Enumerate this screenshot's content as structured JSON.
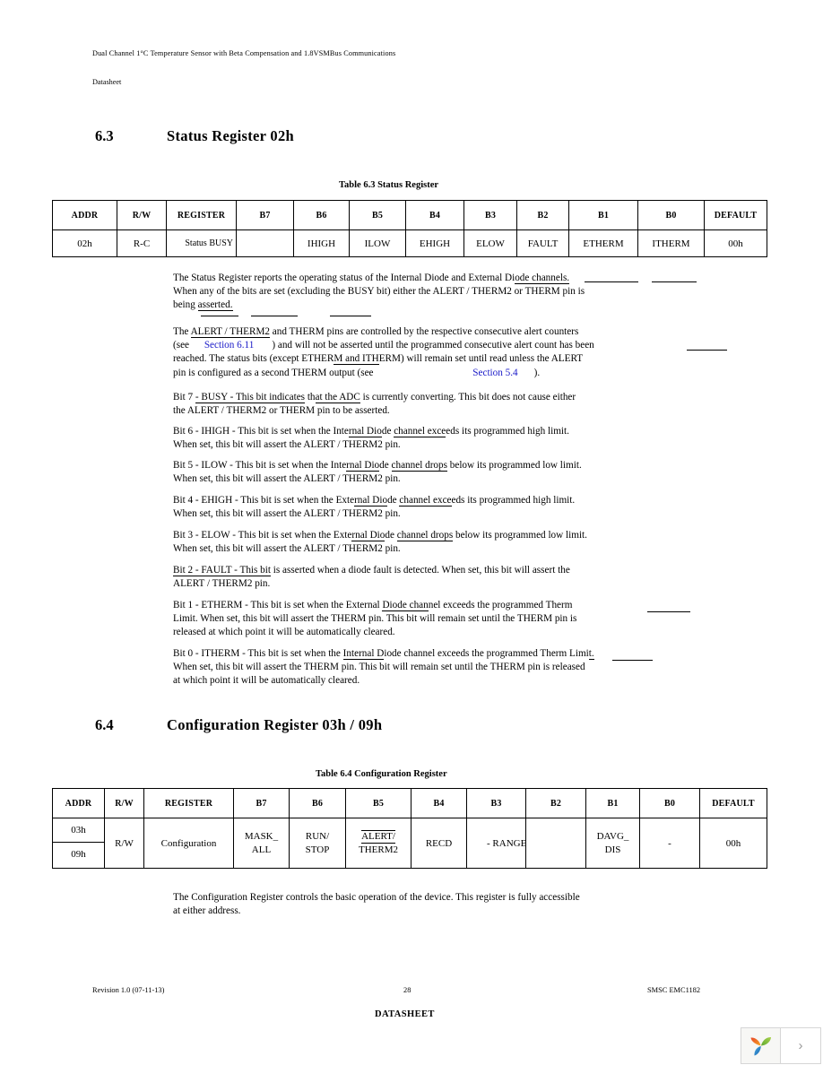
{
  "header": {
    "title": "Dual Channel 1°C Temperature Sensor with Beta Compensation and 1.8VSMBus Communications",
    "subtitle": "Datasheet"
  },
  "sections": [
    {
      "number": "6.3",
      "title": "Status Register 02h"
    },
    {
      "number": "6.4",
      "title": "Configuration Register 03h / 09h"
    }
  ],
  "status_table": {
    "caption": "Table 6.3  Status Register",
    "headers": [
      "ADDR",
      "R/W",
      "REGISTER",
      "B7",
      "B6",
      "B5",
      "B4",
      "B3",
      "B2",
      "B1",
      "B0",
      "DEFAULT"
    ],
    "row": [
      "02h",
      "R-C",
      "Status BUSY",
      "",
      "IHIGH",
      "ILOW",
      "EHIGH",
      "ELOW",
      "FAULT",
      "ETHERM",
      "ITHERM",
      "00h"
    ]
  },
  "config_table": {
    "caption": "Table 6.4  Configuration Register",
    "headers": [
      "ADDR",
      "R/W",
      "REGISTER",
      "B7",
      "B6",
      "B5",
      "B4",
      "B3",
      "B2",
      "B1",
      "B0",
      "DEFAULT"
    ],
    "addr_top": "03h",
    "addr_bottom": "09h",
    "rw": "R/W",
    "register": "Configuration",
    "b7_line1": "MASK_",
    "b7_line2": "ALL",
    "b6_line1": "RUN/",
    "b6_line2": "STOP",
    "b5_line1": "ALERT/",
    "b5_line2": "THERM2",
    "b4": "RECD",
    "b3": "- RANGE",
    "b2": "",
    "b1_line1": "DAVG_",
    "b1_line2": "DIS",
    "b0": "-",
    "default": "00h"
  },
  "body": {
    "p1_l1_a": "The Status Register reports the operating status of the Internal Diode and External Di",
    "p1_l1_b": "ode channels.",
    "p1_l2": "When any of the bits are set (excluding the BUSY bit) either the ALERT / THERM2 or THERM pin is",
    "p1_l3_a": "being ",
    "p1_l3_b": "asserted.",
    "p2_l1_a": "The ",
    "p2_l1_b": "ALERT / THERM2",
    "p2_l1_c": " and THERM pins are controlled by the respective consecutive alert counters",
    "p2_l2_a": "(see ",
    "p2_l2_link": "Section 6.11",
    "p2_l2_b": ") and will not be asserted until the programmed consecutive alert count has been",
    "p2_l3_a": "reached. The status bits (except ETHER",
    "p2_l3_b": "M and ITH",
    "p2_l3_c": "ERM) will remain set until read unless the ALERT",
    "p2_l4_a": "pin is configured as a second THERM output (see ",
    "p2_l4_link": "Section 5.4",
    "p2_l4_b": ").",
    "p3_l1_a": "Bit 7 ",
    "p3_l1_b": "- BUSY -",
    "p3_l1_c": " This bit indicates",
    "p3_l1_d": " th",
    "p3_l1_e": "at the ADC",
    "p3_l1_f": " is currently converting. This bit does not cause either",
    "p3_l2": "the ALERT / THERM2 or THERM pin to be asserted.",
    "p4_l1_a": "Bit 6 - IHIGH - This bit is set when the Inte",
    "p4_l1_b": "rnal Dio",
    "p4_l1_c": "de ",
    "p4_l1_d": "channel exce",
    "p4_l1_e": "eds its programmed high limit.",
    "p4_l2": "When set, this bit will assert the ALERT / THERM2 pin.",
    "p5_l1_a": "Bit 5 - ILOW - This bit is set when the Inte",
    "p5_l1_b": "rnal Dio",
    "p5_l1_c": "de ",
    "p5_l1_d": "channel drops",
    "p5_l1_e": " below its programmed low limit.",
    "p5_l2": "When set, this bit will assert the ALERT / THERM2 pin.",
    "p6_l1_a": "Bit 4 - EHIGH - This bit is set when the Exte",
    "p6_l1_b": "rnal Dio",
    "p6_l1_c": "de ",
    "p6_l1_d": "channel exce",
    "p6_l1_e": "eds its programmed high limit.",
    "p6_l2": "When set, this bit will assert the ALERT / THERM2 pin.",
    "p7_l1_a": "Bit 3 - ELOW - This bit is set when the Exte",
    "p7_l1_b": "rnal Dio",
    "p7_l1_c": "de ",
    "p7_l1_d": "channel drops",
    "p7_l1_e": " below its programmed low limit.",
    "p7_l2": "When set, this bit will assert the ALERT / THERM2 pin.",
    "p8_l1_a": "Bit 2 - FAULT - This bit",
    "p8_l1_b": " is asserted when a diode fault is detected. When set, this bit will assert the",
    "p8_l2": "ALERT / THERM2 pin.",
    "p9_l1_a": "Bit 1 - ETHERM - This bit is set when the External ",
    "p9_l1_b": "Diode chan",
    "p9_l1_c": "nel exceeds the programmed Therm",
    "p9_l2": "Limit. When set, this bit will assert the THERM pin. This bit will remain set until the THERM pin is",
    "p9_l3": "released at which point it will be automatically cleared.",
    "p10_l1_a": "Bit 0 - ITHERM - This bit is set when the ",
    "p10_l1_b": "Internal D",
    "p10_l1_c": "iode channel exceeds the programmed Therm Limi",
    "p10_l1_d": "t.",
    "p10_l2": "When set, this bit will assert the THERM pin. This bit will remain set until the THERM pin is released",
    "p10_l3": "at which point it will be automatically cleared.",
    "p11_l1": "The Configuration Register controls the basic operation of the device. This register is fully accessible",
    "p11_l2": "at either address."
  },
  "footer": {
    "revision": "Revision 1.0 (07-11-13)",
    "page_number": "28",
    "part": "SMSC EMC1182",
    "label": "DATASHEET"
  },
  "nav_widget": {
    "logo_icon": "leaf-logo-icon",
    "next_label": "›"
  },
  "colors": {
    "link": "#1a1aC8",
    "text": "#000000",
    "logo_orange": "#ee7f2a",
    "logo_red": "#e04b2a",
    "logo_green": "#8dc63f",
    "logo_blue": "#2a7fc9"
  }
}
